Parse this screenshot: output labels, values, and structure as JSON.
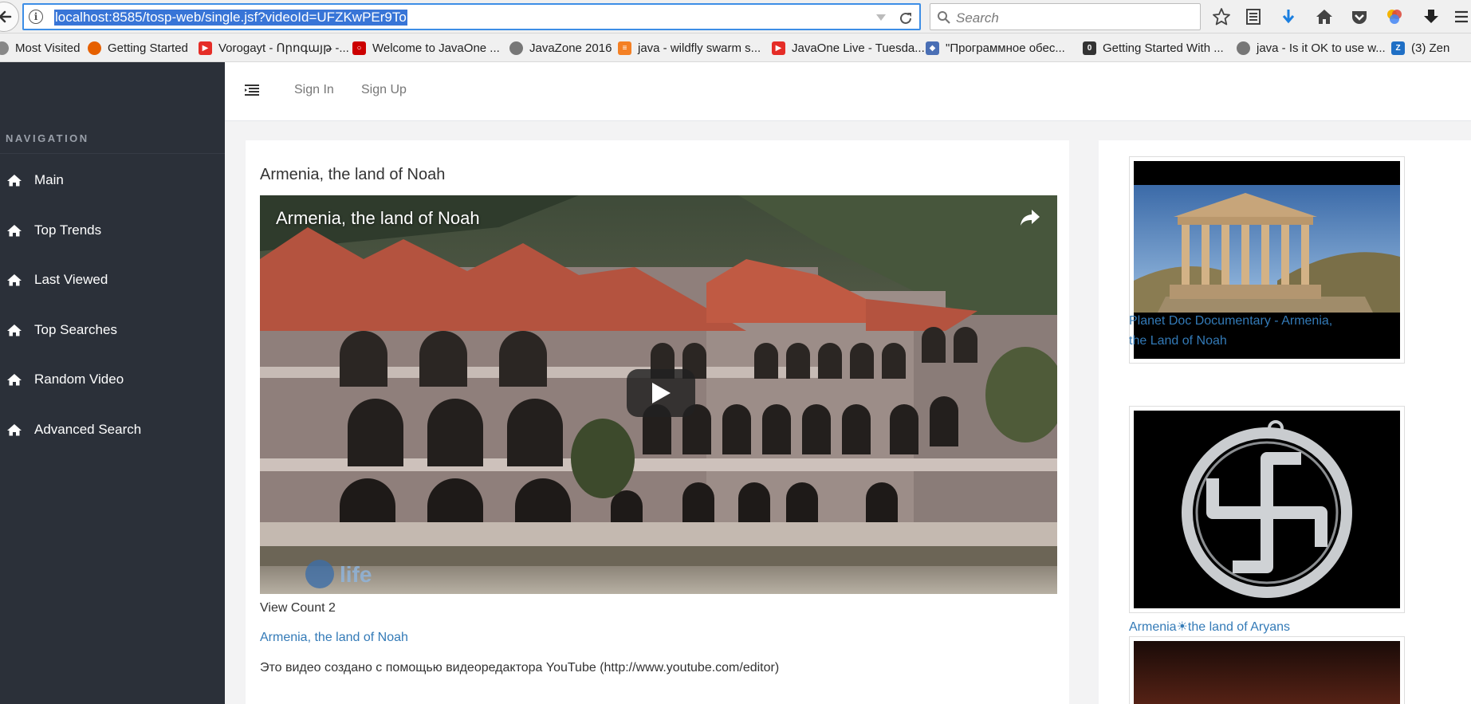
{
  "browser": {
    "url": "localhost:8585/tosp-web/single.jsf?videoId=UFZKwPEr9To",
    "search_placeholder": "Search",
    "bookmarks": [
      {
        "label": "Most Visited",
        "icon": "gear-icon",
        "color": "#888888"
      },
      {
        "label": "Getting Started",
        "icon": "firefox-icon",
        "color": "#e66000"
      },
      {
        "label": "Vorogayt - Որոգայթ -...",
        "icon": "youtube-icon",
        "color": "#e52d27"
      },
      {
        "label": "Welcome to JavaOne ...",
        "icon": "oracle-icon",
        "color": "#cc0000"
      },
      {
        "label": "JavaZone 2016",
        "icon": "globe-icon",
        "color": "#777777"
      },
      {
        "label": "java - wildfly swarm s...",
        "icon": "stackoverflow-icon",
        "color": "#f48024"
      },
      {
        "label": "JavaOne Live - Tuesda...",
        "icon": "youtube-icon",
        "color": "#e52d27"
      },
      {
        "label": "\"Программное обес...",
        "icon": "cube-icon",
        "color": "#4a6fb5"
      },
      {
        "label": "Getting Started With ...",
        "icon": "document-icon",
        "color": "#333333"
      },
      {
        "label": "java - Is it OK to use w...",
        "icon": "globe-icon",
        "color": "#777777"
      },
      {
        "label": "(3) Zen",
        "icon": "zen-icon",
        "color": "#1f6fc5"
      }
    ]
  },
  "sidebar": {
    "heading": "NAVIGATION",
    "items": [
      {
        "label": "Main"
      },
      {
        "label": "Top Trends"
      },
      {
        "label": "Last Viewed"
      },
      {
        "label": "Top Searches"
      },
      {
        "label": "Random Video"
      },
      {
        "label": "Advanced Search"
      }
    ]
  },
  "header": {
    "sign_in": "Sign In",
    "sign_up": "Sign Up"
  },
  "video": {
    "title": "Armenia, the land of Noah",
    "player_title": "Armenia, the land of Noah",
    "view_count": "View Count 2",
    "link": "Armenia, the land of Noah",
    "description": "Это видео создано с помощью видеоредактора YouTube (http://www.youtube.com/editor)"
  },
  "related": [
    {
      "title": "Planet Doc Documentary - Armenia, the Land of Noah"
    },
    {
      "title": "Armenia☀the land of Aryans"
    }
  ],
  "colors": {
    "sidebar_bg": "#2b3039",
    "link": "#337ab7",
    "url_highlight": "#3875d7"
  }
}
